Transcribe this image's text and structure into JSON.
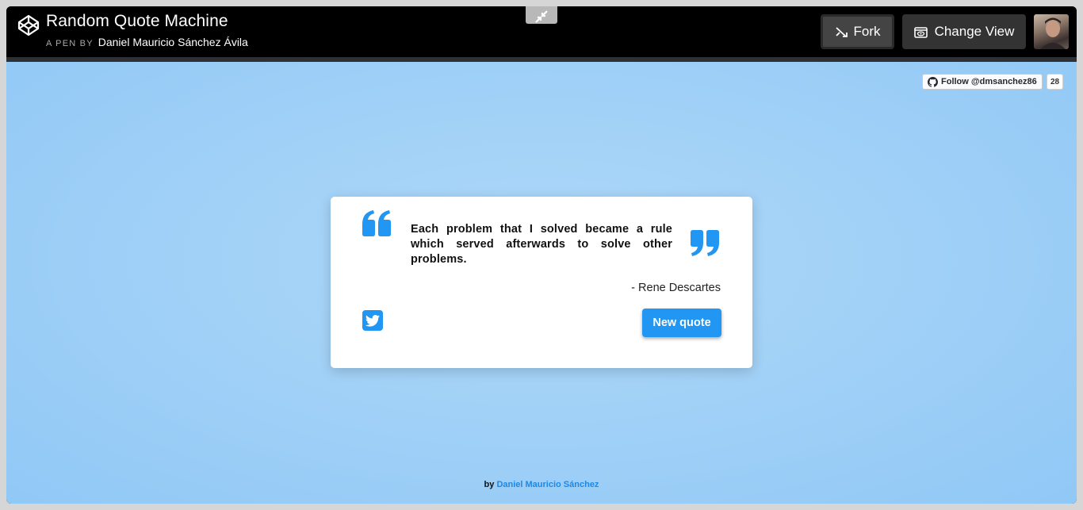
{
  "header": {
    "title": "Random Quote Machine",
    "a_pen_by": "A PEN BY",
    "author": "Daniel Mauricio Sánchez Ávila",
    "fork_label": "Fork",
    "change_view_label": "Change View"
  },
  "github": {
    "follow_label": "Follow @dmsanchez86",
    "count": "28"
  },
  "quote": {
    "text": "Each problem that I solved became a rule which served afterwards to solve other problems.",
    "author": "- Rene Descartes",
    "new_quote_label": "New quote"
  },
  "footer": {
    "by": "by",
    "author_link": "Daniel Mauricio Sánchez"
  },
  "colors": {
    "accent": "#2196f3",
    "header_bg": "#000000",
    "background": "#a2d1f7"
  },
  "icons": [
    "codepen-logo-icon",
    "collapse-icon",
    "fork-icon",
    "eye-icon",
    "github-icon",
    "quote-open-icon",
    "quote-close-icon",
    "twitter-icon"
  ]
}
